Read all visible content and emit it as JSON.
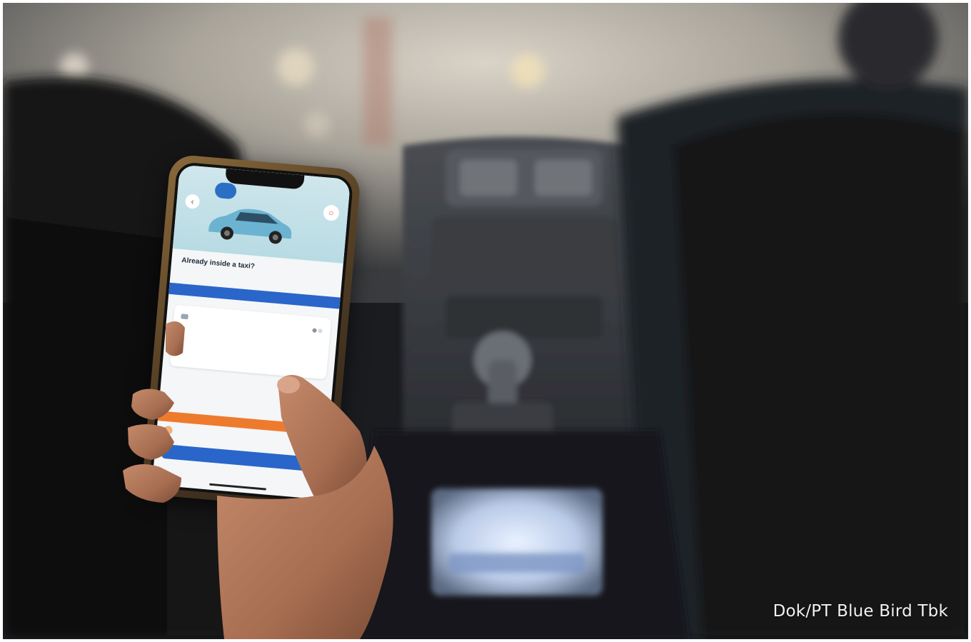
{
  "caption": "Dok/PT Blue Bird Tbk",
  "phone_screen": {
    "pin_label": "",
    "title": "Already inside a taxi?",
    "subtitle": "",
    "blue_banner": "",
    "taxi_number": "",
    "destination_placeholder": "",
    "orange_banner": "",
    "rating_hint": "",
    "cta_label": ""
  },
  "icons": {
    "back": "chevron-left-icon",
    "sos": "sos-icon",
    "taxi": "taxi-icon",
    "destination": "location-dot-icon"
  },
  "colors": {
    "brand_blue": "#2a66c9",
    "alert_orange": "#ee7b2d",
    "car_blue": "#6bb3d1"
  }
}
